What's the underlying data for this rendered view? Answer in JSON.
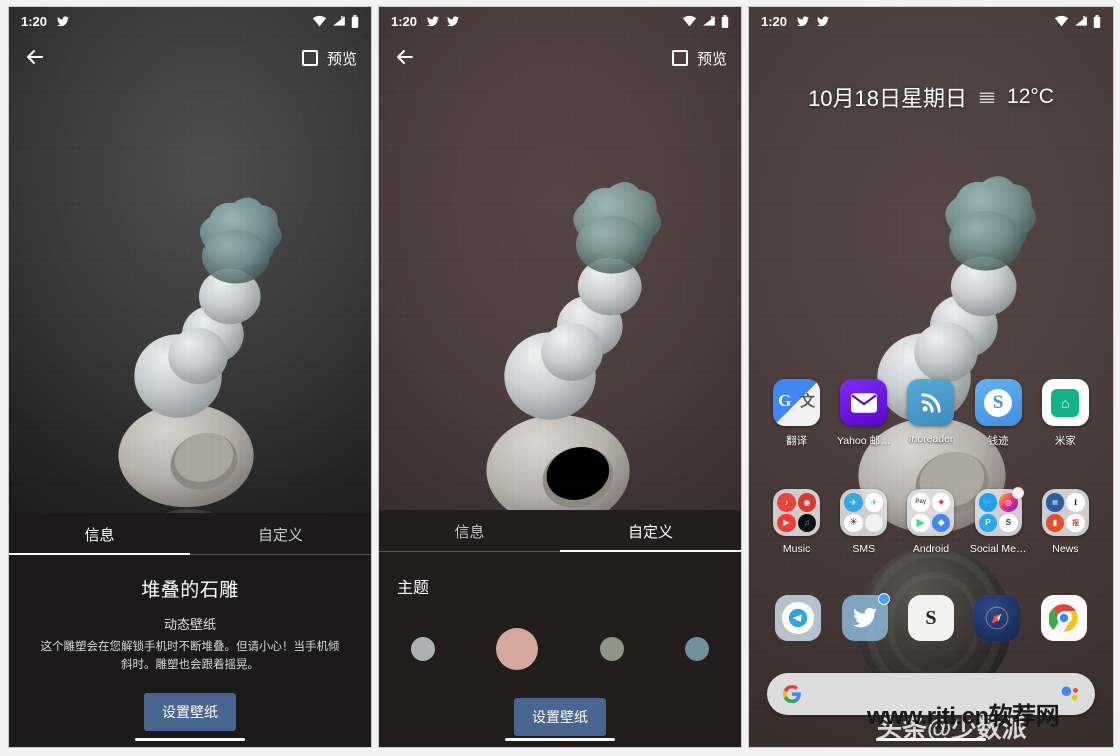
{
  "statusbar": {
    "time": "1:20",
    "icons": [
      "twitter-icon",
      "wifi-icon",
      "signal-icon",
      "battery-icon"
    ]
  },
  "panel1": {
    "name": "wallpaper-info-screen",
    "topbar": {
      "back_icon": "back-arrow-icon",
      "preview_label": "预览",
      "checkbox_icon": "checkbox-unchecked-icon"
    },
    "tabs": [
      {
        "label": "信息",
        "active": true
      },
      {
        "label": "自定义",
        "active": false
      }
    ],
    "title": "堆叠的石雕",
    "subtitle": "动态壁纸",
    "description": "这个雕塑会在您解锁手机时不断堆叠。但请小心！当手机倾斜时。雕塑也会跟着摇晃。",
    "primary_button": "设置壁纸",
    "accent_color": "#4b6591"
  },
  "panel2": {
    "name": "wallpaper-customize-screen",
    "topbar": {
      "back_icon": "back-arrow-icon",
      "preview_label": "预览",
      "checkbox_icon": "checkbox-unchecked-icon"
    },
    "tabs": [
      {
        "label": "信息",
        "active": false
      },
      {
        "label": "自定义",
        "active": true
      }
    ],
    "section_label": "主题",
    "swatches": [
      {
        "name": "swatch-gray",
        "color": "#a9b2b6",
        "selected": false
      },
      {
        "name": "swatch-pink",
        "color": "#d6a79d",
        "selected": true
      },
      {
        "name": "swatch-green",
        "color": "#8d9686",
        "selected": false
      },
      {
        "name": "swatch-teal",
        "color": "#6f909c",
        "selected": false
      }
    ],
    "primary_button": "设置壁纸",
    "accent_color": "#4b6591"
  },
  "panel3": {
    "name": "home-screen",
    "date": "10月18日星期日",
    "weather_icon": "fog-icon",
    "temperature": "12°C",
    "app_rows": [
      [
        {
          "label": "翻译",
          "icon": "google-translate-icon"
        },
        {
          "label": "Yahoo 邮…",
          "icon": "yahoo-mail-icon"
        },
        {
          "label": "Inoreader",
          "icon": "inoreader-icon"
        },
        {
          "label": "钱迹",
          "icon": "qianji-icon"
        },
        {
          "label": "米家",
          "icon": "mijia-icon"
        }
      ],
      [
        {
          "label": "Music",
          "icon": "folder-icon"
        },
        {
          "label": "SMS",
          "icon": "folder-icon"
        },
        {
          "label": "Android",
          "icon": "folder-icon"
        },
        {
          "label": "Social Me…",
          "icon": "folder-icon"
        },
        {
          "label": "News",
          "icon": "folder-icon"
        }
      ]
    ],
    "dock": [
      {
        "name": "telegram-icon"
      },
      {
        "name": "twitter-icon"
      },
      {
        "name": "shadowrocket-icon"
      },
      {
        "name": "compass-icon"
      },
      {
        "name": "chrome-icon"
      }
    ],
    "search": {
      "google_icon": "google-g-icon",
      "assistant_icon": "google-assistant-icon",
      "placeholder": ""
    }
  },
  "watermarks": {
    "primary": "www.rjti.cn软荐网",
    "secondary": "头条@少数派"
  }
}
